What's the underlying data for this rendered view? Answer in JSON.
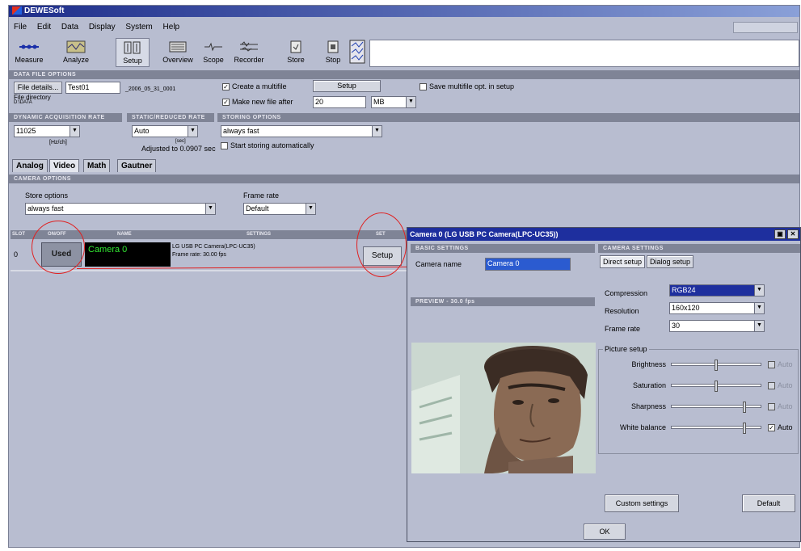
{
  "app": {
    "title": "DEWESoft"
  },
  "menu": [
    "File",
    "Edit",
    "Data",
    "Display",
    "System",
    "Help"
  ],
  "toolbar": {
    "buttons": [
      {
        "label": "Measure"
      },
      {
        "label": "Analyze"
      },
      {
        "label": "Setup"
      },
      {
        "label": "Overview"
      },
      {
        "label": "Scope"
      },
      {
        "label": "Recorder"
      },
      {
        "label": "Store"
      },
      {
        "label": "Stop"
      }
    ]
  },
  "data_file": {
    "section": "DATA FILE OPTIONS",
    "file_details_button": "File details...",
    "file_name": "Test01",
    "file_suffix": "_2006_05_31_0001",
    "file_dir_label": "File directory",
    "file_dir_value": "D:\\DATA",
    "create_multifile": "Create a multifile",
    "make_new_file": "Make new file after",
    "new_file_value": "20",
    "new_file_unit": "MB",
    "setup_button": "Setup",
    "save_multifile": "Save multifile opt. in setup"
  },
  "acquisition": {
    "section_rate": "DYNAMIC ACQUISITION RATE",
    "section_static": "STATIC/REDUCED RATE",
    "section_storing": "STORING OPTIONS",
    "rate_value": "11025",
    "rate_unit": "[Hz/ch]",
    "static_value": "Auto",
    "static_unit": "[sec]",
    "adjusted_label": "Adjusted to 0.0907 sec",
    "storing_value": "always fast",
    "start_storing": "Start storing automatically"
  },
  "tabs": [
    {
      "label": "Analog"
    },
    {
      "label": "Video"
    },
    {
      "label": "Math"
    },
    {
      "label": "Gautner"
    }
  ],
  "camera_options": {
    "section": "CAMERA OPTIONS",
    "store_label": "Store options",
    "store_value": "always fast",
    "frame_label": "Frame rate",
    "frame_value": "Default"
  },
  "grid": {
    "headers": [
      "SLOT",
      "ON/OFF",
      "NAME",
      "SETTINGS",
      "SET"
    ],
    "rows": [
      {
        "slot": "0",
        "state": "Used",
        "name": "Camera 0",
        "settings_line1": "LG USB PC Camera(LPC-UC35)",
        "settings_line2": "Frame rate: 30.00 fps",
        "set": "Setup"
      }
    ]
  },
  "dialog": {
    "title": "Camera 0 (LG USB PC Camera(LPC-UC35))",
    "basic_section": "BASIC SETTINGS",
    "camera_name_label": "Camera name",
    "camera_name_value": "Camera 0",
    "preview_section": "PREVIEW - 30.0 fps",
    "camera_section": "CAMERA SETTINGS",
    "direct_setup": "Direct setup",
    "dialog_setup": "Dialog setup",
    "compression_label": "Compression",
    "compression_value": "RGB24",
    "resolution_label": "Resolution",
    "resolution_value": "160x120",
    "framerate_label": "Frame rate",
    "framerate_value": "30",
    "picture_setup": "Picture setup",
    "brightness": "Brightness",
    "saturation": "Saturation",
    "sharpness": "Sharpness",
    "white_balance": "White balance",
    "auto": "Auto",
    "custom_settings": "Custom settings",
    "default_button": "Default",
    "ok_button": "OK",
    "levels": {
      "brightness": 0.5,
      "saturation": 0.5,
      "sharpness": 0.82,
      "white_balance": 0.82
    },
    "white_balance_auto": true
  },
  "colors": {
    "annotation": "#e02020",
    "camera_name_text": "#32e832",
    "title_blue": "#1e2f9e"
  }
}
